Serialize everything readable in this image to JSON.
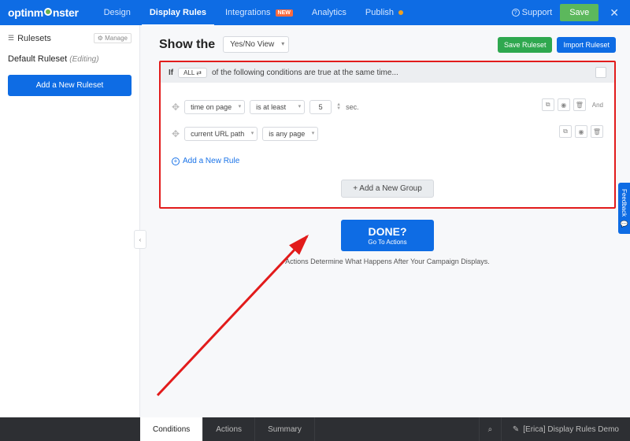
{
  "brand": {
    "prefix": "optinm",
    "suffix": "nster"
  },
  "topnav": {
    "design": "Design",
    "display_rules": "Display Rules",
    "integrations": "Integrations",
    "integrations_badge": "NEW",
    "analytics": "Analytics",
    "publish": "Publish"
  },
  "top_right": {
    "support": "Support",
    "save": "Save",
    "close": "✕"
  },
  "sidebar": {
    "title": "Rulesets",
    "manage": "⚙ Manage",
    "default_ruleset": "Default Ruleset",
    "editing": "(Editing)",
    "add_ruleset": "Add a New Ruleset",
    "collapse_glyph": "‹"
  },
  "main": {
    "show_the": "Show the",
    "view": "Yes/No View",
    "save_ruleset": "Save Ruleset",
    "import_ruleset": "Import Ruleset"
  },
  "group": {
    "if": "If",
    "all_chip": "ALL ⇄",
    "cond_text": "of the following conditions are true at the same time..."
  },
  "rules": [
    {
      "field": "time on page",
      "op": "is at least",
      "value": "5",
      "unit": "sec.",
      "show_and": true
    },
    {
      "field": "current URL path",
      "op": "is any page",
      "value": null,
      "unit": null,
      "show_and": false
    }
  ],
  "actions": {
    "add_rule": "Add a New Rule",
    "add_group": "+ Add a New Group",
    "done_big": "DONE?",
    "done_small": "Go To Actions",
    "help": "Actions Determine What Happens After Your Campaign Displays."
  },
  "feedback": "Feedback",
  "bottom": {
    "conditions": "Conditions",
    "actions": "Actions",
    "summary": "Summary",
    "campaign": "[Erica] Display Rules Demo"
  },
  "icons": {
    "search": "⌕",
    "pencil": "✎",
    "copy": "⧉",
    "eye": "◉",
    "trash": "🗑",
    "list": "☰",
    "support": "?"
  },
  "colors": {
    "primary": "#0e6ce4",
    "success": "#5cb85c",
    "highlight_border": "#e21b1b",
    "arrow": "#e21b1b"
  }
}
